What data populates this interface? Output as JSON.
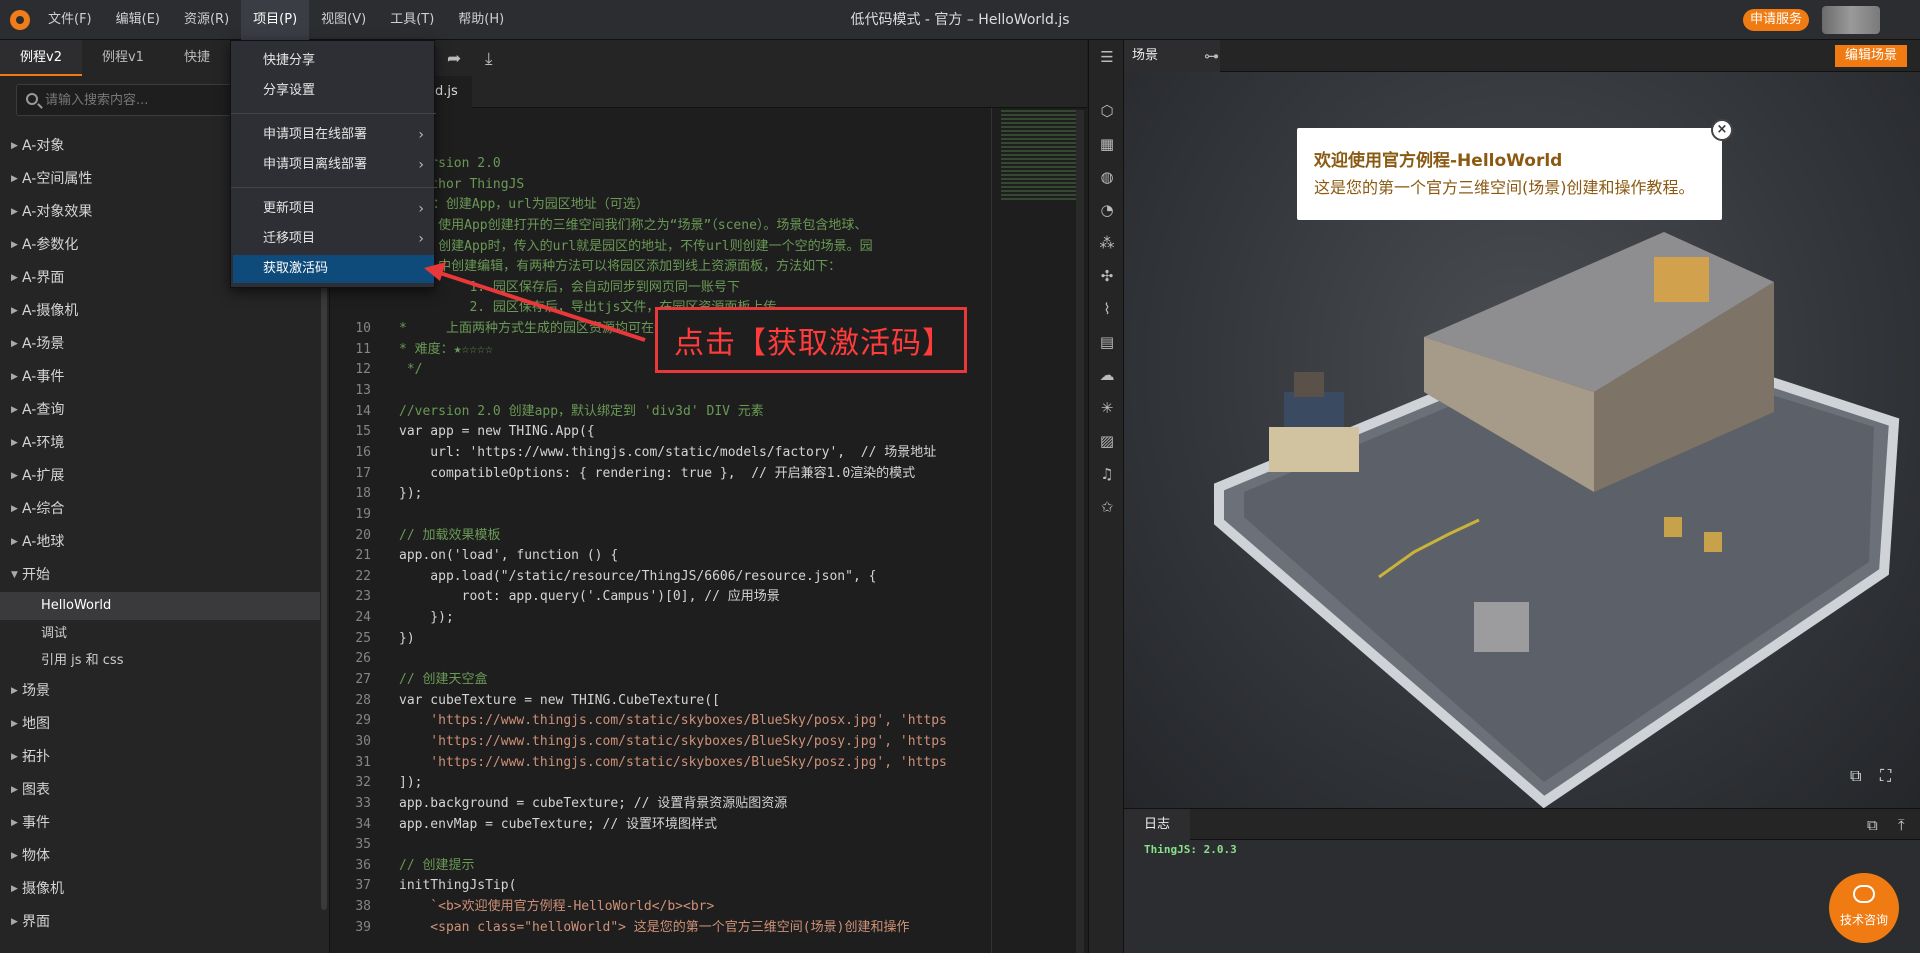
{
  "topbar": {
    "menu": [
      "文件(F)",
      "编辑(E)",
      "资源(R)",
      "项目(P)",
      "视图(V)",
      "工具(T)",
      "帮助(H)"
    ],
    "title": "低代码模式 - 官方 – HelloWorld.js",
    "apply_service": "申请服务"
  },
  "left": {
    "tabs": [
      "例程v2",
      "例程v1",
      "快捷"
    ],
    "search_placeholder": "请输入搜索内容...",
    "tree": [
      "A-对象",
      "A-空间属性",
      "A-对象效果",
      "A-参数化",
      "A-界面",
      "A-摄像机",
      "A-场景",
      "A-事件",
      "A-查询",
      "A-环境",
      "A-扩展",
      "A-综合",
      "A-地球"
    ],
    "open_node": "开始",
    "children": [
      "HelloWorld",
      "调试",
      "引用 js 和 css"
    ],
    "tree_after": [
      "场景",
      "地图",
      "拓扑",
      "图表",
      "事件",
      "物体",
      "摄像机",
      "界面"
    ]
  },
  "editor": {
    "tab": "d.js",
    "lines": [
      {
        "n": "",
        "t": " @version 2.0",
        "c": "c-comment"
      },
      {
        "n": "",
        "t": " @author ThingJS",
        "c": "c-comment"
      },
      {
        "n": "",
        "t": " 说明：创建App，url为园区地址（可选）",
        "c": "c-comment"
      },
      {
        "n": "",
        "t": "     使用App创建打开的三维空间我们称之为“场景”（scene）。场景包含地球、",
        "c": "c-comment"
      },
      {
        "n": "",
        "t": "     创建App时，传入的url就是园区的地址，不传url则创建一个空的场景。园",
        "c": "c-comment"
      },
      {
        "n": "",
        "t": "     中创建编辑，有两种方法可以将园区添加到线上资源面板，方法如下：",
        "c": "c-comment"
      },
      {
        "n": "",
        "t": "         1. 园区保存后，会自动同步到网页同一账号下",
        "c": "c-comment"
      },
      {
        "n": "",
        "t": "         2. 园区保存后，导出tjs文件，在园区资源面板上传",
        "c": "c-comment"
      },
      {
        "n": "10",
        "t": "*     上面两种方式生成的园区资源均可在资源面板中双击自动生成脚本",
        "c": "c-comment"
      },
      {
        "n": "11",
        "t": "* 难度：★☆☆☆☆",
        "c": "c-comment"
      },
      {
        "n": "12",
        "t": " */",
        "c": "c-comment"
      },
      {
        "n": "13",
        "t": "",
        "c": ""
      },
      {
        "n": "14",
        "t": "//version 2.0 创建app，默认绑定到 'div3d' DIV 元素",
        "c": "c-comment"
      },
      {
        "n": "15",
        "t": "var app = new THING.App({",
        "c": ""
      },
      {
        "n": "16",
        "t": "    url: 'https://www.thingjs.com/static/models/factory',  // 场景地址",
        "c": ""
      },
      {
        "n": "17",
        "t": "    compatibleOptions: { rendering: true },  // 开启兼容1.0渲染的模式",
        "c": ""
      },
      {
        "n": "18",
        "t": "});",
        "c": ""
      },
      {
        "n": "19",
        "t": "",
        "c": ""
      },
      {
        "n": "20",
        "t": "// 加载效果模板",
        "c": "c-comment"
      },
      {
        "n": "21",
        "t": "app.on('load', function () {",
        "c": ""
      },
      {
        "n": "22",
        "t": "    app.load(\"/static/resource/ThingJS/6606/resource.json\", {",
        "c": ""
      },
      {
        "n": "23",
        "t": "        root: app.query('.Campus')[0], // 应用场景",
        "c": ""
      },
      {
        "n": "24",
        "t": "    });",
        "c": ""
      },
      {
        "n": "25",
        "t": "})",
        "c": ""
      },
      {
        "n": "26",
        "t": "",
        "c": ""
      },
      {
        "n": "27",
        "t": "// 创建天空盒",
        "c": "c-comment"
      },
      {
        "n": "28",
        "t": "var cubeTexture = new THING.CubeTexture([",
        "c": ""
      },
      {
        "n": "29",
        "t": "    'https://www.thingjs.com/static/skyboxes/BlueSky/posx.jpg', 'https",
        "c": "c-str"
      },
      {
        "n": "30",
        "t": "    'https://www.thingjs.com/static/skyboxes/BlueSky/posy.jpg', 'https",
        "c": "c-str"
      },
      {
        "n": "31",
        "t": "    'https://www.thingjs.com/static/skyboxes/BlueSky/posz.jpg', 'https",
        "c": "c-str"
      },
      {
        "n": "32",
        "t": "]);",
        "c": ""
      },
      {
        "n": "33",
        "t": "app.background = cubeTexture; // 设置背景资源贴图资源",
        "c": ""
      },
      {
        "n": "34",
        "t": "app.envMap = cubeTexture; // 设置环境图样式",
        "c": ""
      },
      {
        "n": "35",
        "t": "",
        "c": ""
      },
      {
        "n": "36",
        "t": "// 创建提示",
        "c": "c-comment"
      },
      {
        "n": "37",
        "t": "initThingJsTip(",
        "c": ""
      },
      {
        "n": "38",
        "t": "    `<b>欢迎使用官方例程-HelloWorld</b><br>",
        "c": "c-str"
      },
      {
        "n": "39",
        "t": "    <span class=\"helloWorld\"> 这是您的第一个官方三维空间(场景)创建和操作",
        "c": "c-str"
      }
    ]
  },
  "popup": {
    "items": [
      "快捷分享",
      "分享设置",
      "申请项目在线部署",
      "申请项目离线部署",
      "更新项目",
      "迁移项目",
      "获取激活码"
    ]
  },
  "annotation": "点击【获取激活码】",
  "scene": {
    "tab": "场景",
    "edit_button": "编辑场景",
    "tip_title": "欢迎使用官方例程-HelloWorld",
    "tip_body": "这是您的第一个官方三维空间(场景)创建和操作教程。",
    "log_tab": "日志",
    "log_line": "ThingJS: 2.0.3",
    "consult": "技术咨询"
  },
  "colors": {
    "accent": "#ef7b12",
    "highlight": "#0e4a7a",
    "annotation": "#e8383a"
  }
}
